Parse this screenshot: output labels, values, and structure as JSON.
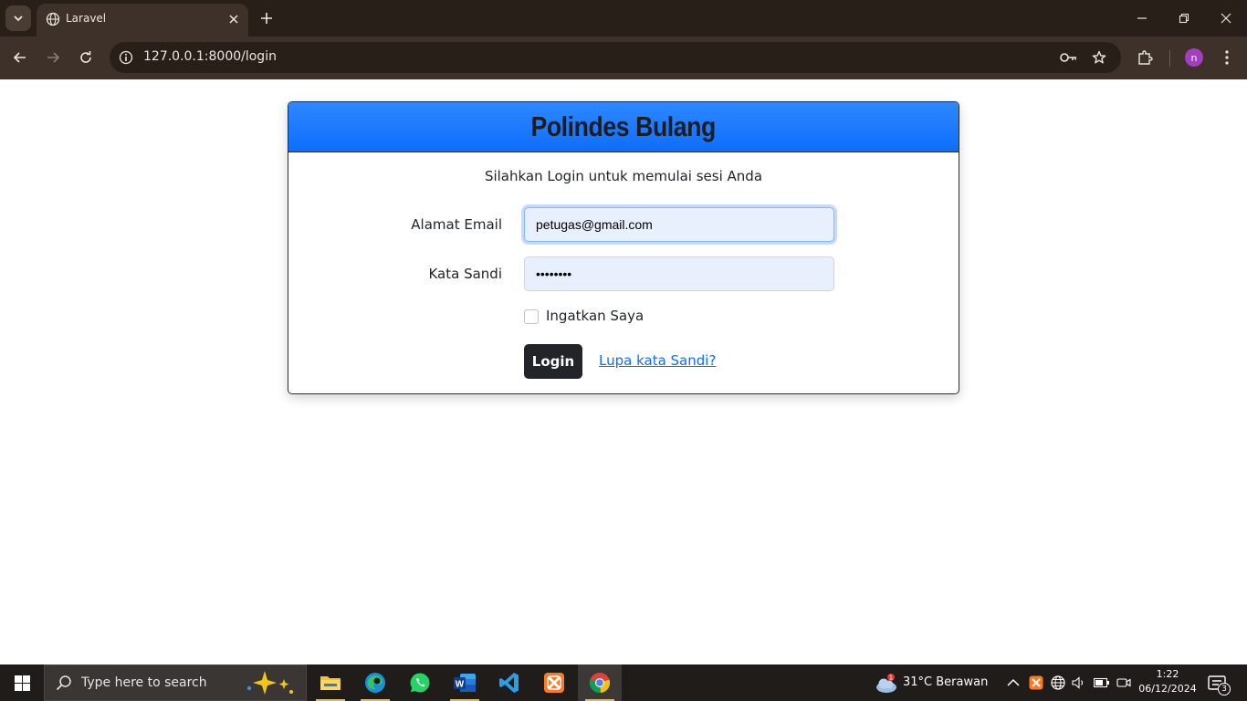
{
  "browser": {
    "tab_title": "Laravel",
    "url": "127.0.0.1:8000/login",
    "profile_initial": "n"
  },
  "page": {
    "title": "Polindes Bulang",
    "subtitle": "Silahkan Login untuk memulai sesi Anda",
    "email_label": "Alamat Email",
    "email_value": "petugas@gmail.com",
    "password_label": "Kata Sandi",
    "password_value": "••••••••",
    "remember_label": "Ingatkan Saya",
    "login_button": "Login",
    "forgot_link": "Lupa kata Sandi?",
    "header_color": "#0d6efd"
  },
  "taskbar": {
    "search_placeholder": "Type here to search",
    "weather_text": "31°C  Berawan",
    "weather_badge": "1",
    "time": "1:22",
    "date": "06/12/2024",
    "notification_count": "3",
    "apps": [
      "file-explorer-icon",
      "edge-icon",
      "whatsapp-icon",
      "word-icon",
      "vscode-icon",
      "xampp-icon",
      "chrome-icon"
    ]
  }
}
